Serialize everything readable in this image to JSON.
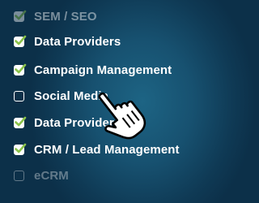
{
  "checklist": {
    "items": [
      {
        "label": "SEM / SEO",
        "checked": true,
        "state": "faded"
      },
      {
        "label": "Data Providers",
        "checked": true,
        "state": "normal"
      },
      {
        "label": "Campaign Management",
        "checked": true,
        "state": "normal"
      },
      {
        "label": "Social Media",
        "checked": false,
        "state": "normal"
      },
      {
        "label": "Data Providers",
        "checked": true,
        "state": "normal"
      },
      {
        "label": "CRM / Lead Management",
        "checked": true,
        "state": "normal"
      },
      {
        "label": "eCRM",
        "checked": false,
        "state": "faded"
      }
    ]
  },
  "cursor": {
    "icon": "hand-pointer-icon"
  },
  "colors": {
    "background": "#175170",
    "check": "#8bc34a",
    "text": "#ffffff"
  }
}
